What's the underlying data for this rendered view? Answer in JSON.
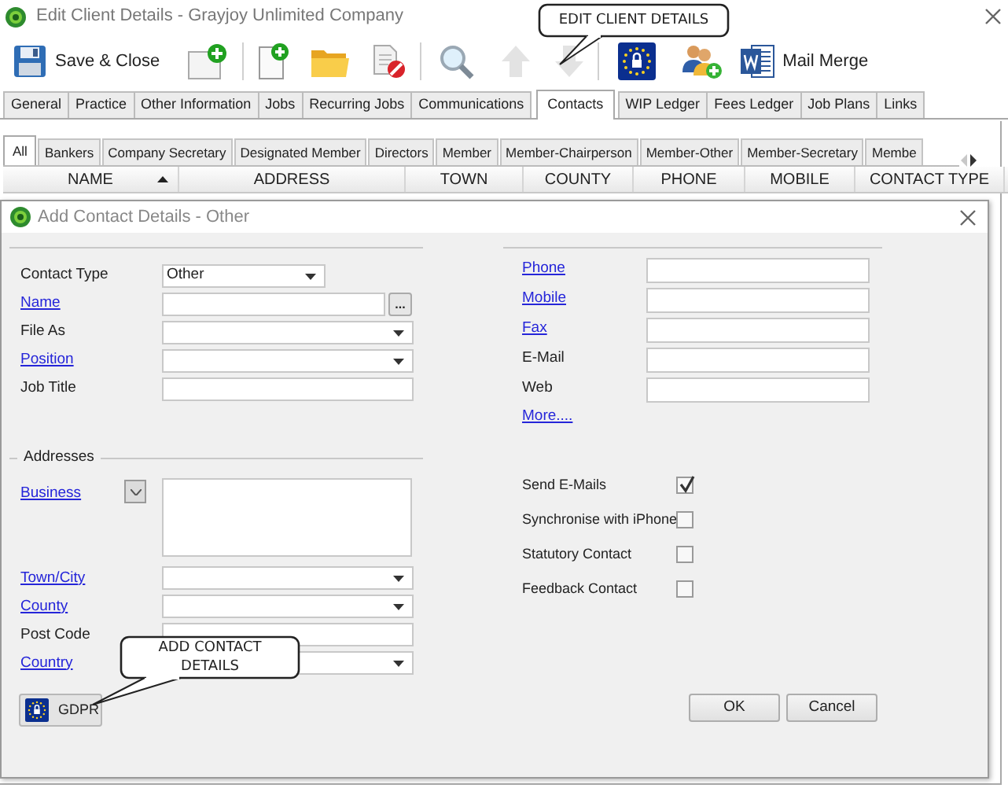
{
  "window": {
    "title": "Edit Client Details - Grayjoy Unlimited Company"
  },
  "toolbar": [
    {
      "kind": "button",
      "label": "Save & Close",
      "disabled": false
    },
    {
      "kind": "button",
      "disabled": false
    },
    {
      "kind": "separator"
    },
    {
      "kind": "button",
      "disabled": false
    },
    {
      "kind": "button",
      "disabled": false
    },
    {
      "kind": "button",
      "disabled": false
    },
    {
      "kind": "separator"
    },
    {
      "kind": "button",
      "disabled": false
    },
    {
      "kind": "button",
      "disabled": true
    },
    {
      "kind": "button",
      "disabled": true
    },
    {
      "kind": "separator"
    },
    {
      "kind": "button",
      "disabled": false
    },
    {
      "kind": "button",
      "disabled": false
    },
    {
      "kind": "button",
      "label": "Mail Merge",
      "disabled": false
    }
  ],
  "callouts": [
    {
      "text": "EDIT CLIENT DETAILS"
    },
    {
      "text": "ADD CONTACT DETAILS"
    }
  ],
  "tabs": [
    {
      "label": "General",
      "selected": false
    },
    {
      "label": "Practice",
      "selected": false
    },
    {
      "label": "Other Information",
      "selected": false
    },
    {
      "label": "Jobs",
      "selected": false
    },
    {
      "label": "Recurring Jobs",
      "selected": false
    },
    {
      "label": "Communications",
      "selected": false
    },
    {
      "label": "Contacts",
      "selected": true
    },
    {
      "label": "WIP Ledger",
      "selected": false
    },
    {
      "label": "Fees Ledger",
      "selected": false
    },
    {
      "label": "Job Plans",
      "selected": false
    },
    {
      "label": "Links",
      "selected": false
    }
  ],
  "contact_tabs": [
    {
      "label": "All",
      "selected": true
    },
    {
      "label": "Bankers",
      "selected": false
    },
    {
      "label": "Company Secretary",
      "selected": false
    },
    {
      "label": "Designated Member",
      "selected": false
    },
    {
      "label": "Directors",
      "selected": false
    },
    {
      "label": "Member",
      "selected": false
    },
    {
      "label": "Member-Chairperson",
      "selected": false
    },
    {
      "label": "Member-Other",
      "selected": false
    },
    {
      "label": "Member-Secretary",
      "selected": false
    },
    {
      "label": "Membe",
      "selected": false
    }
  ],
  "grid": {
    "columns": [
      {
        "label": "NAME",
        "sorted": true
      },
      {
        "label": "ADDRESS",
        "sorted": false
      },
      {
        "label": "TOWN",
        "sorted": false
      },
      {
        "label": "COUNTY",
        "sorted": false
      },
      {
        "label": "PHONE",
        "sorted": false
      },
      {
        "label": "MOBILE",
        "sorted": false
      },
      {
        "label": "CONTACT TYPE",
        "sorted": false
      }
    ]
  },
  "dialog": {
    "title": "Add Contact Details - Other",
    "details": [
      {
        "label": "Contact Type",
        "link": false,
        "kind": "select",
        "value": "Other"
      },
      {
        "label": "Name",
        "link": true,
        "kind": "lookup",
        "button": "..."
      },
      {
        "label": "File As",
        "link": false,
        "kind": "dropdown"
      },
      {
        "label": "Position",
        "link": true,
        "kind": "dropdown"
      },
      {
        "label": "Job Title",
        "link": false,
        "kind": "text"
      }
    ],
    "addresses": {
      "title": "Addresses",
      "fields": [
        {
          "label": "Business",
          "link": true,
          "kind": "multiline"
        },
        {
          "label": "Town/City",
          "link": true,
          "kind": "dropdown"
        },
        {
          "label": "County",
          "link": true,
          "kind": "dropdown"
        },
        {
          "label": "Post Code",
          "link": false,
          "kind": "text"
        },
        {
          "label": "Country",
          "link": true,
          "kind": "dropdown"
        }
      ]
    },
    "contact": [
      {
        "label": "Phone",
        "link": true
      },
      {
        "label": "Mobile",
        "link": true
      },
      {
        "label": "Fax",
        "link": true
      },
      {
        "label": "E-Mail",
        "link": false
      },
      {
        "label": "Web",
        "link": false
      }
    ],
    "more_link": "More....",
    "options": [
      {
        "label": "Send E-Mails",
        "checked": true
      },
      {
        "label": "Synchronise with iPhone",
        "checked": false
      },
      {
        "label": "Statutory Contact",
        "checked": false
      },
      {
        "label": "Feedback Contact",
        "checked": false
      }
    ],
    "gdpr_button": "GDPR",
    "buttons": [
      "OK",
      "Cancel"
    ]
  }
}
